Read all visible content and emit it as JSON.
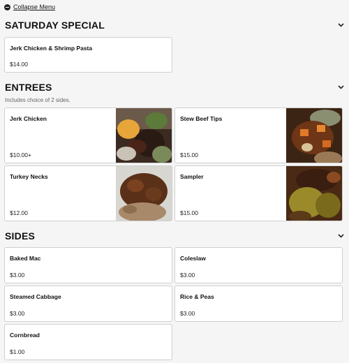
{
  "collapse_menu": {
    "label": "Collapse Menu"
  },
  "sections": [
    {
      "title": "SATURDAY SPECIAL",
      "items": [
        {
          "name": "Jerk Chicken & Shrimp Pasta",
          "price": "$14.00"
        }
      ]
    },
    {
      "title": "ENTREES",
      "note": "Includes choice of 2 sides.",
      "items": [
        {
          "name": "Jerk Chicken",
          "price": "$10.00+"
        },
        {
          "name": "Stew Beef Tips",
          "price": "$15.00"
        },
        {
          "name": "Turkey Necks",
          "price": "$12.00"
        },
        {
          "name": "Sampler",
          "price": "$15.00"
        }
      ]
    },
    {
      "title": "SIDES",
      "items": [
        {
          "name": "Baked Mac",
          "price": "$3.00"
        },
        {
          "name": "Coleslaw",
          "price": "$3.00"
        },
        {
          "name": "Steamed Cabbage",
          "price": "$3.00"
        },
        {
          "name": "Rice & Peas",
          "price": "$3.00"
        },
        {
          "name": "Cornbread",
          "price": "$1.00"
        }
      ]
    }
  ]
}
